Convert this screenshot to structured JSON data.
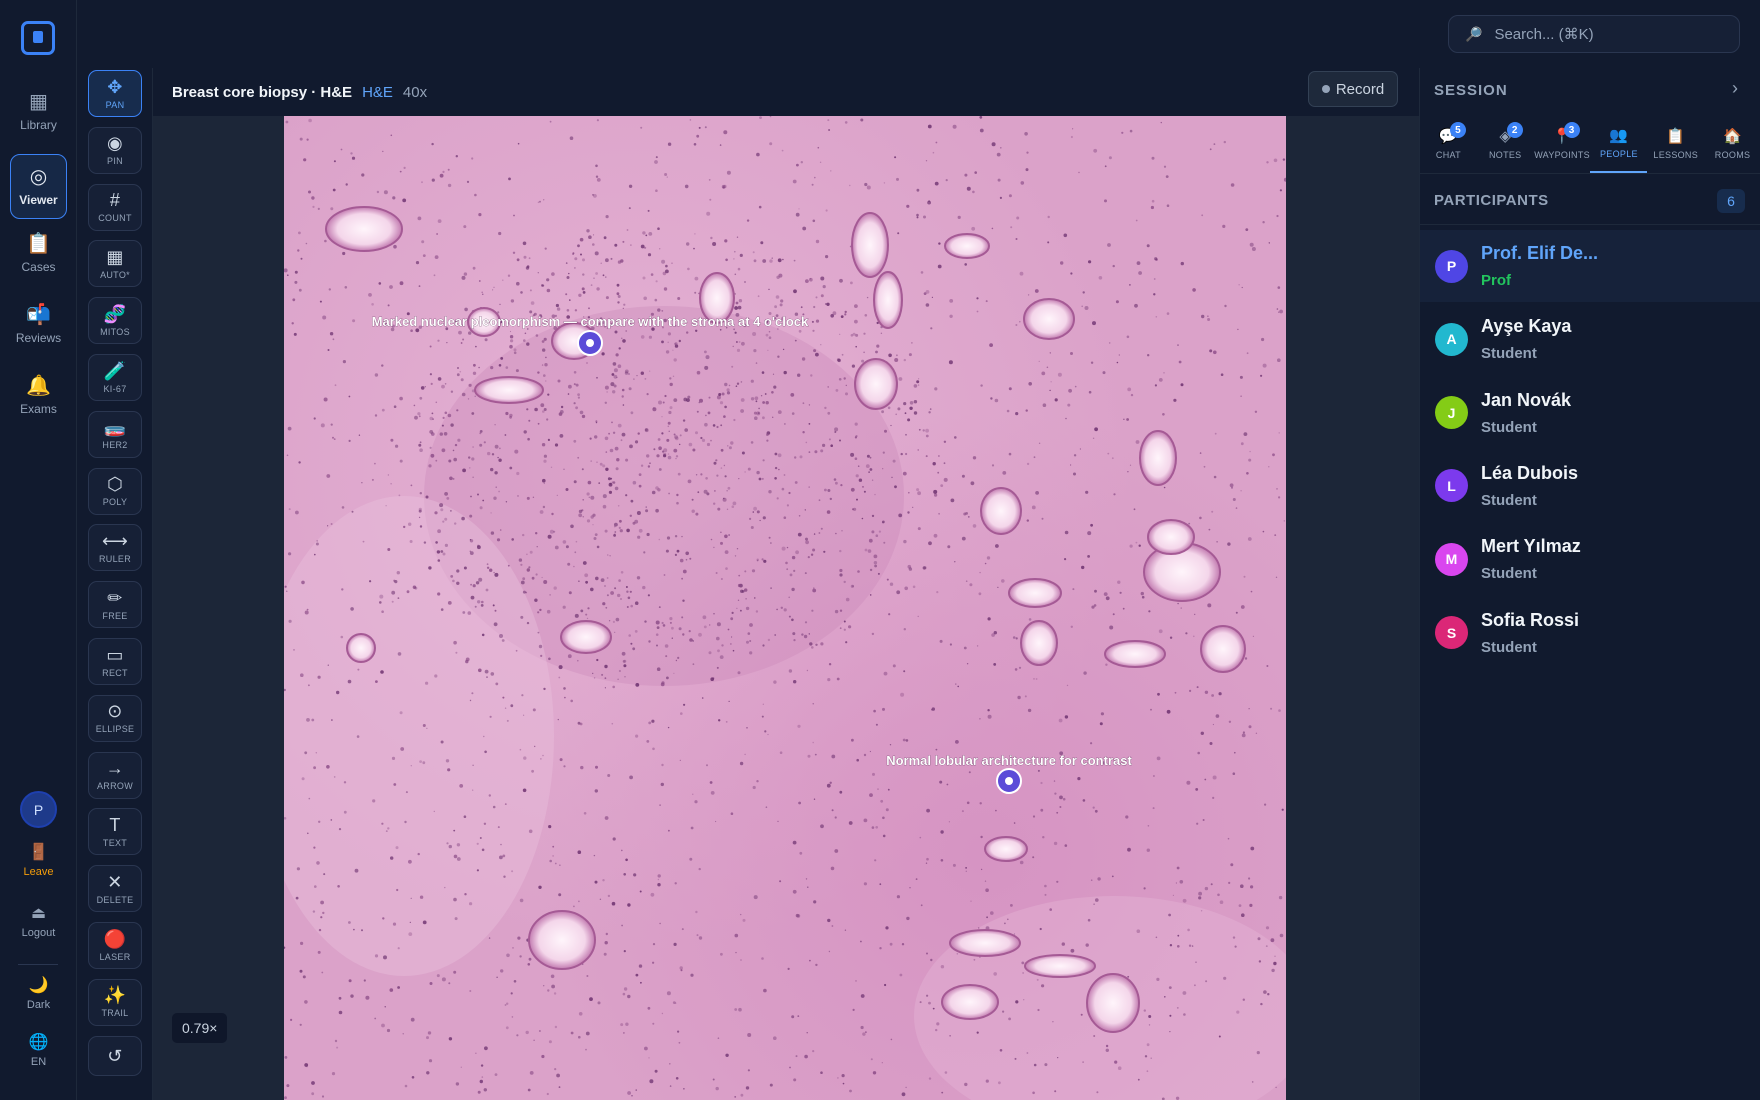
{
  "search": {
    "placeholder": "Search...  (⌘K)",
    "icon": "magnifier-icon"
  },
  "nav": {
    "items": [
      {
        "label": "Library",
        "icon": "library-icon",
        "glyph": "▦"
      },
      {
        "label": "Viewer",
        "icon": "viewer-icon",
        "glyph": "◎"
      },
      {
        "label": "Cases",
        "icon": "cases-icon",
        "glyph": "📋"
      },
      {
        "label": "Reviews",
        "icon": "reviews-icon",
        "glyph": "📬"
      },
      {
        "label": "Exams",
        "icon": "exams-icon",
        "glyph": "🔔"
      }
    ],
    "user_initial": "P",
    "leave": "Leave",
    "logout": "Logout",
    "theme": "Dark",
    "language": "EN"
  },
  "tools": [
    {
      "label": "PAN",
      "glyph": "✥"
    },
    {
      "label": "PIN",
      "glyph": "◉"
    },
    {
      "label": "COUNT",
      "glyph": "#"
    },
    {
      "label": "AUTO*",
      "glyph": "▦"
    },
    {
      "label": "MITOS",
      "glyph": "🧬"
    },
    {
      "label": "KI-67",
      "glyph": "🧪"
    },
    {
      "label": "HER2",
      "glyph": "🧫"
    },
    {
      "label": "POLY",
      "glyph": "⬡"
    },
    {
      "label": "RULER",
      "glyph": "⟷"
    },
    {
      "label": "FREE",
      "glyph": "✏"
    },
    {
      "label": "RECT",
      "glyph": "▭"
    },
    {
      "label": "ELLIPSE",
      "glyph": "⊙"
    },
    {
      "label": "ARROW",
      "glyph": "→"
    },
    {
      "label": "TEXT",
      "glyph": "T"
    },
    {
      "label": "DELETE",
      "glyph": "✕"
    },
    {
      "label": "LASER",
      "glyph": "🔴"
    },
    {
      "label": "TRAIL",
      "glyph": "✨"
    },
    {
      "label": "",
      "glyph": "↺"
    }
  ],
  "viewer": {
    "title": "Breast core biopsy · H&E",
    "stain": "H&E",
    "magnification": "40x",
    "record_label": "Record",
    "zoom": "0.79×",
    "annotations": [
      "Marked nuclear pleomorphism — compare with the stroma at 4 o'clock",
      "Normal lobular architecture for contrast"
    ]
  },
  "panel": {
    "title": "SESSION",
    "tabs": [
      {
        "label": "CHAT",
        "glyph": "💬",
        "badge": "5"
      },
      {
        "label": "NOTES",
        "glyph": "◈",
        "badge": "2"
      },
      {
        "label": "WAYPOINTS",
        "glyph": "📍",
        "badge": "3"
      },
      {
        "label": "PEOPLE",
        "glyph": "👥",
        "badge": ""
      },
      {
        "label": "LESSONS",
        "glyph": "📋",
        "badge": ""
      },
      {
        "label": "ROOMS",
        "glyph": "🏠",
        "badge": ""
      }
    ],
    "participants_title": "PARTICIPANTS",
    "participants_count": "6",
    "participants": [
      {
        "initial": "P",
        "name": "Prof. Elif De...",
        "role": "Prof",
        "color": "#4f46e5"
      },
      {
        "initial": "A",
        "name": "Ayşe Kaya",
        "role": "Student",
        "color": "#22b8cf"
      },
      {
        "initial": "J",
        "name": "Jan Novák",
        "role": "Student",
        "color": "#84cc16"
      },
      {
        "initial": "L",
        "name": "Léa Dubois",
        "role": "Student",
        "color": "#7c3aed"
      },
      {
        "initial": "M",
        "name": "Mert Yılmaz",
        "role": "Student",
        "color": "#d946ef"
      },
      {
        "initial": "S",
        "name": "Sofia Rossi",
        "role": "Student",
        "color": "#db2777"
      }
    ]
  }
}
